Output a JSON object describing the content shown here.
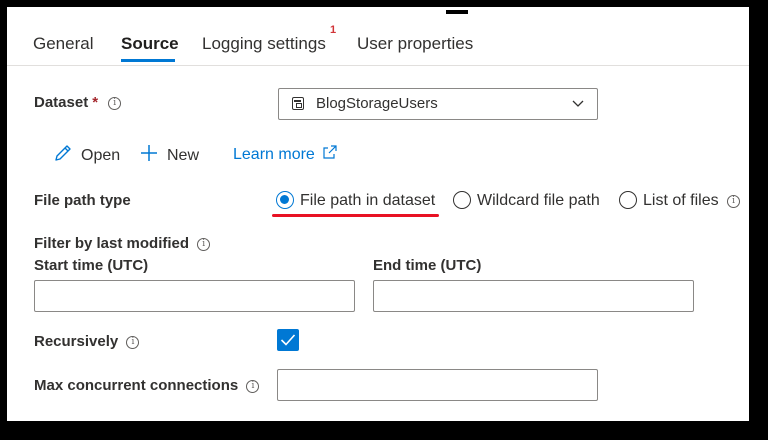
{
  "tabs": [
    {
      "label": "General"
    },
    {
      "label": "Source"
    },
    {
      "label": "Logging settings",
      "badge": "1"
    },
    {
      "label": "User properties"
    }
  ],
  "dataset": {
    "label": "Dataset",
    "required_mark": "*",
    "value": "BlogStorageUsers"
  },
  "actions": {
    "open_label": "Open",
    "new_label": "New",
    "learn_more_label": "Learn more"
  },
  "file_path_type": {
    "label": "File path type",
    "options": [
      {
        "label": "File path in dataset",
        "checked": true
      },
      {
        "label": "Wildcard file path",
        "checked": false
      },
      {
        "label": "List of files",
        "checked": false
      }
    ]
  },
  "filter": {
    "label": "Filter by last modified",
    "start_label": "Start time (UTC)",
    "end_label": "End time (UTC)",
    "start_value": "",
    "end_value": ""
  },
  "recursively": {
    "label": "Recursively",
    "checked": true
  },
  "max_connections": {
    "label": "Max concurrent connections",
    "value": ""
  },
  "colors": {
    "accent": "#0078d4",
    "highlight": "#e81123",
    "badge": "#d13438"
  }
}
